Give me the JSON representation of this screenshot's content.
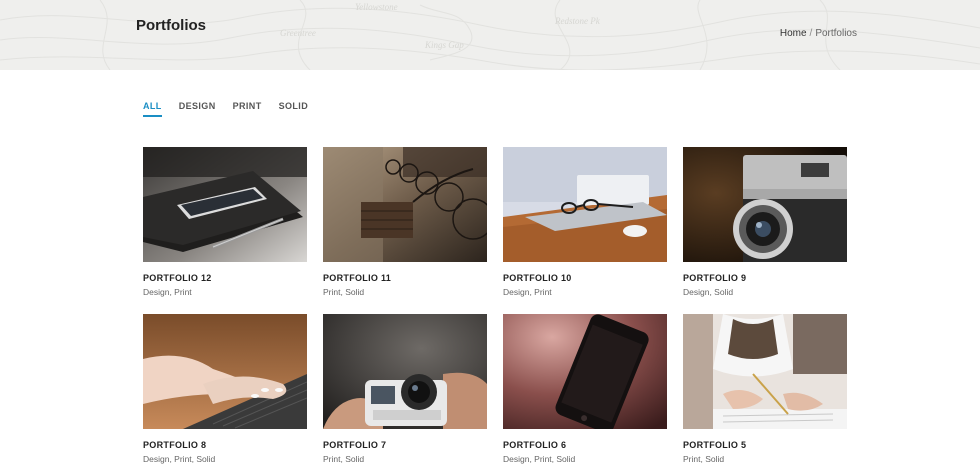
{
  "header": {
    "title": "Portfolios",
    "breadcrumb": {
      "home": "Home",
      "separator": "/",
      "current": "Portfolios"
    },
    "map_labels": [
      "Yellowstone",
      "Redstone Pk",
      "Greentree",
      "Kings Gap"
    ]
  },
  "filters": [
    {
      "label": "ALL",
      "active": true
    },
    {
      "label": "DESIGN",
      "active": false
    },
    {
      "label": "PRINT",
      "active": false
    },
    {
      "label": "SOLID",
      "active": false
    }
  ],
  "portfolios": [
    {
      "title": "PORTFOLIO 12",
      "categories": "Design, Print",
      "image": "phone-on-notebook"
    },
    {
      "title": "PORTFOLIO 11",
      "categories": "Print, Solid",
      "image": "bicycles-on-street"
    },
    {
      "title": "PORTFOLIO 10",
      "categories": "Design, Print",
      "image": "glasses-on-laptop"
    },
    {
      "title": "PORTFOLIO 9",
      "categories": "Design, Solid",
      "image": "vintage-camera"
    },
    {
      "title": "PORTFOLIO 8",
      "categories": "Design, Print, Solid",
      "image": "hands-typing"
    },
    {
      "title": "PORTFOLIO 7",
      "categories": "Print, Solid",
      "image": "action-camera"
    },
    {
      "title": "PORTFOLIO 6",
      "categories": "Design, Print, Solid",
      "image": "smartphone-dark"
    },
    {
      "title": "PORTFOLIO 5",
      "categories": "Print, Solid",
      "image": "person-writing"
    }
  ],
  "colors": {
    "accent": "#1a8ec4",
    "header_bg": "#efefed",
    "title": "#222222",
    "meta": "#666666"
  }
}
